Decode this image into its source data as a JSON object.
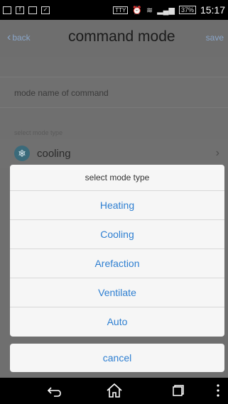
{
  "status_bar": {
    "time": "15:17",
    "battery": "37%",
    "icons": [
      "screenshot-icon",
      "facebook-icon",
      "usb-icon",
      "clipboard-icon",
      "tty-icon",
      "alarm-icon",
      "wifi-icon",
      "signal-icon",
      "battery-icon"
    ]
  },
  "header": {
    "back_label": "back",
    "title": "command mode",
    "save_label": "save"
  },
  "form": {
    "name_placeholder": "mode name of command",
    "mode_section_label": "select mode type",
    "mode_value": "cooling"
  },
  "dialog": {
    "title": "select mode type",
    "options": [
      "Heating",
      "Cooling",
      "Arefaction",
      "Ventilate",
      "Auto"
    ],
    "cancel_label": "cancel"
  },
  "colors": {
    "dialog_text": "#2e7fd1",
    "overlay": "#6f6f6f"
  }
}
